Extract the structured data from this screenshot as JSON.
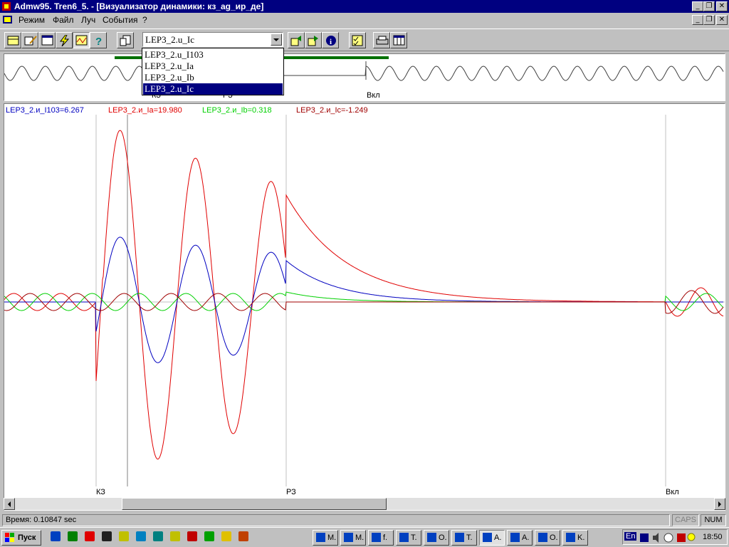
{
  "window": {
    "title": "Admw95. Tren6_5.  - [Визуализатор динамики: кз_ag_ир_де]",
    "caption_min": "_",
    "caption_restore": "❐",
    "caption_close": "✕"
  },
  "menu": {
    "items": [
      {
        "label": "Режим"
      },
      {
        "label": "Файл"
      },
      {
        "label": "Луч"
      },
      {
        "label": "События"
      },
      {
        "label": "?"
      }
    ]
  },
  "toolbar": {
    "combo_value": "LEP3_2.u_Ic",
    "dropdown_options": [
      "LEP3_2.u_I103",
      "LEP3_2.u_Ia",
      "LEP3_2.u_Ib",
      "LEP3_2.u_Ic"
    ],
    "dropdown_selected_index": 3
  },
  "overview": {
    "markers": [
      "КЗ",
      "РЗ",
      "Вкл"
    ]
  },
  "plot": {
    "readouts": [
      {
        "text": "LEP3_2.и_I103=6.267",
        "color": "#0000c0"
      },
      {
        "text": "LEP3_2.и_Ia=19.980",
        "color": "#e00000"
      },
      {
        "text": "LEP3_2.и_Ib=0.318",
        "color": "#00d000"
      },
      {
        "text": "LEP3_2.и_Ic=-1.249",
        "color": "#a00000"
      }
    ],
    "event_markers": [
      "КЗ",
      "РЗ",
      "Вкл"
    ]
  },
  "status": {
    "time": "Время: 0.10847 sec",
    "caps": "CAPS",
    "num": "NUM"
  },
  "taskbar": {
    "start": "Пуск",
    "tasks": [
      "M.",
      "M.",
      "f.",
      "T.",
      "O.",
      "T.",
      "A.",
      "A.",
      "O.",
      "K."
    ],
    "lang": "En",
    "clock": "18:50"
  }
}
